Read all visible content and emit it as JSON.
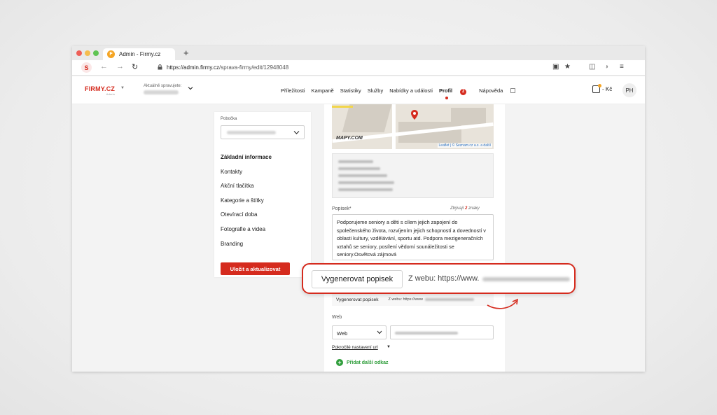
{
  "browser": {
    "tab_title": "Admin - Firmy.cz",
    "tab_favicon": "F",
    "new_tab": "+",
    "url_host": "https://admin.firmy.cz",
    "url_path": "/sprava-firmy/edit/12948048"
  },
  "header": {
    "logo": "FIRMY.CZ",
    "logo_sub": "Admin",
    "managed_label": "Aktuálně spravujete:",
    "nav": [
      {
        "label": "Příležitosti"
      },
      {
        "label": "Kampaně"
      },
      {
        "label": "Statistiky"
      },
      {
        "label": "Služby"
      },
      {
        "label": "Nabídky a události"
      },
      {
        "label": "Profil",
        "badge": "2"
      },
      {
        "label": "Nápověda"
      }
    ],
    "wallet": "- Kč",
    "avatar": "PH"
  },
  "sidebar": {
    "branch_label": "Pobočka",
    "menu": [
      {
        "label": "Základní informace"
      },
      {
        "label": "Kontakty"
      },
      {
        "label": "Akční tlačítka"
      },
      {
        "label": "Kategorie a štítky"
      },
      {
        "label": "Otevírací doba"
      },
      {
        "label": "Fotografie a videa"
      },
      {
        "label": "Branding"
      }
    ],
    "save_button": "Uložit a aktualizovat"
  },
  "map": {
    "brand": "MAPY.COM",
    "attribution": "Leaflet | © Seznam.cz a.s. a další"
  },
  "description": {
    "label": "Popisek*",
    "counter_prefix": "Zbývají",
    "counter_value": "2",
    "counter_suffix": "znaky",
    "text": "Podporujeme seniory a děti s cílem jejich zapojení do společenského života, rozvíjením jejich schopností a dovedností v oblasti kultury, vzdělávání, sportu atd. Podpora mezigeneračních vztahů se seniory, posílení vědomí sounáležitosti se seniory.Osvětová zájmová"
  },
  "generate": {
    "button": "Vygenerovat popisek",
    "web_label": "Z webu: https://www"
  },
  "callout": {
    "button": "Vygenerovat popisek",
    "web_label": "Z webu: https://www."
  },
  "web": {
    "label": "Web",
    "type_value": "Web",
    "advanced_link": "Pokročilé nastavení url",
    "add_link": "Přidat další odkaz"
  },
  "colors": {
    "brand_red": "#d52b1e",
    "green": "#2e9d3a"
  }
}
